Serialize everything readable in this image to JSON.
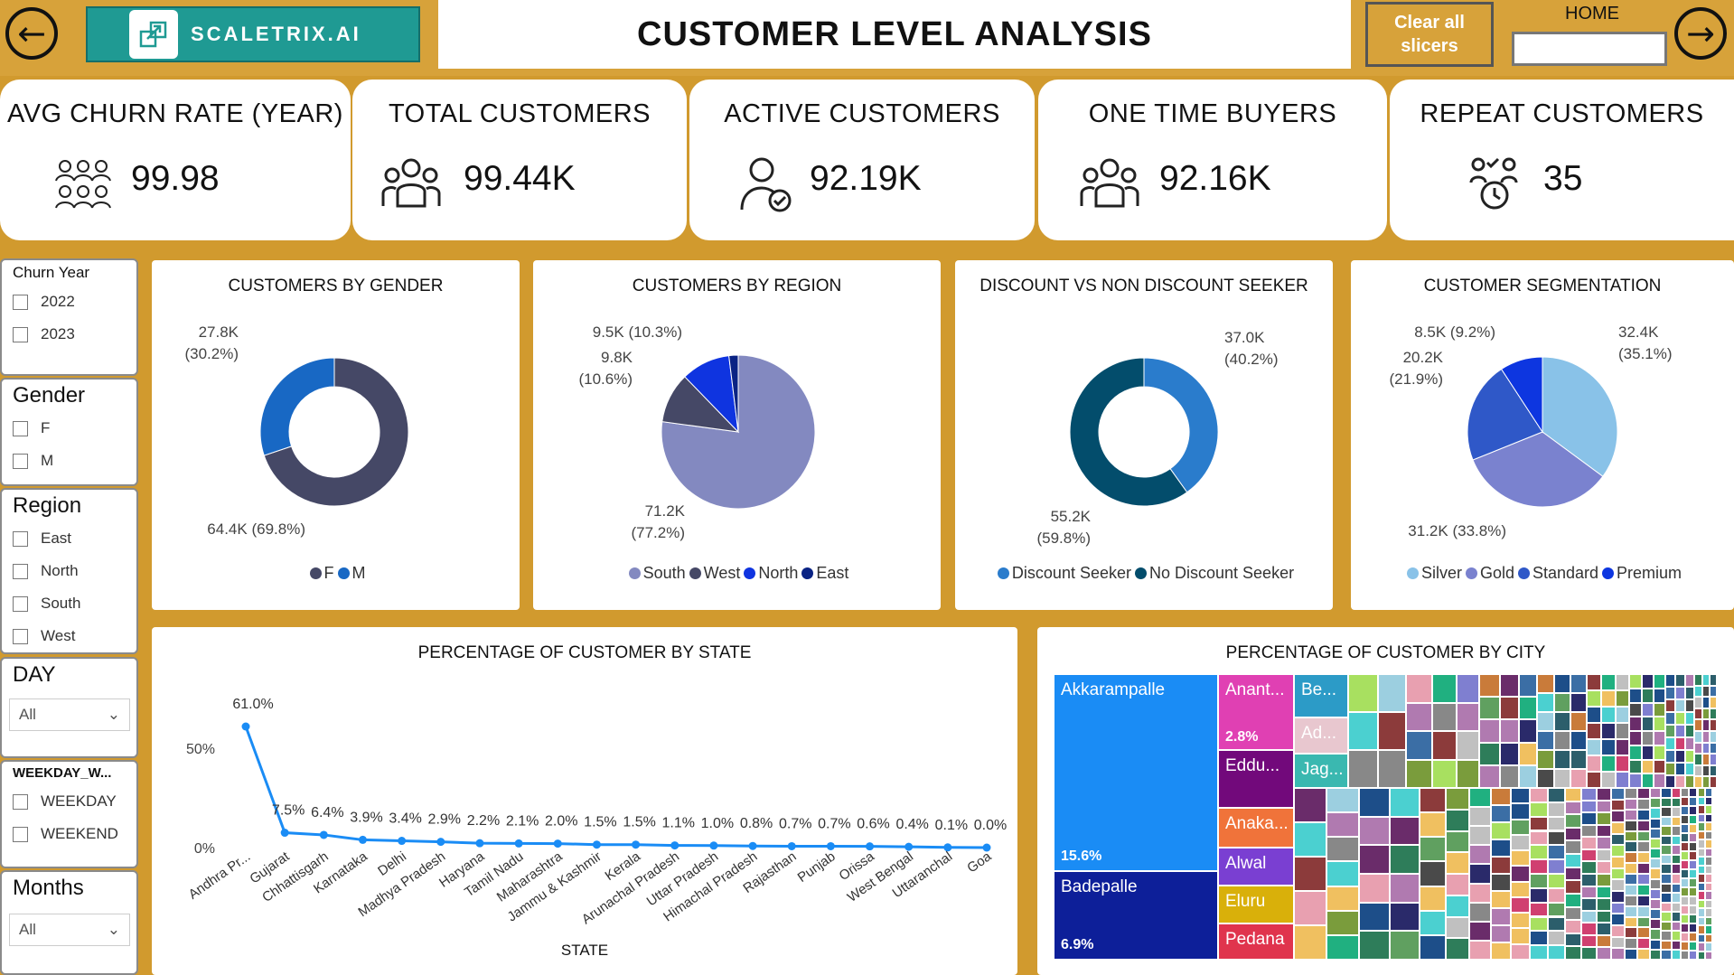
{
  "header": {
    "title": "CUSTOMER LEVEL ANALYSIS",
    "logo_text": "SCALETRIX.AI",
    "clear_label": "Clear all slicers",
    "home_label": "HOME",
    "back_icon": "arrow-left-icon",
    "forward_icon": "arrow-right-icon"
  },
  "kpis": [
    {
      "title": "AVG CHURN RATE (YEAR)",
      "value": "99.98",
      "icon": "churn-group-icon"
    },
    {
      "title": "TOTAL CUSTOMERS",
      "value": "99.44K",
      "icon": "people-icon"
    },
    {
      "title": "ACTIVE CUSTOMERS",
      "value": "92.19K",
      "icon": "user-check-icon"
    },
    {
      "title": "ONE TIME BUYERS",
      "value": "92.16K",
      "icon": "people-icon"
    },
    {
      "title": "REPEAT CUSTOMERS",
      "value": "35",
      "icon": "repeat-customer-icon"
    }
  ],
  "slicers": {
    "churn_year": {
      "title": "Churn Year",
      "options": [
        "2022",
        "2023"
      ]
    },
    "gender": {
      "title": "Gender",
      "options": [
        "F",
        "M"
      ]
    },
    "region": {
      "title": "Region",
      "options": [
        "East",
        "North",
        "South",
        "West"
      ]
    },
    "day": {
      "title": "DAY",
      "value": "All"
    },
    "weekday": {
      "title": "WEEKDAY_W...",
      "options": [
        "WEEKDAY",
        "WEEKEND"
      ]
    },
    "months": {
      "title": "Months",
      "value": "All"
    }
  },
  "colors": {
    "navy_gray": "#454866",
    "blue": "#1868c4",
    "lavender": "#8389c0",
    "bright_blue": "#0f34e0",
    "dark_blue": "#0a2384",
    "discount": "#2a7ccc",
    "no_discount": "#034d6c",
    "silver": "#89c2e8",
    "gold": "#7a82cf",
    "standard": "#2f58c8",
    "premium": "#0d36e0",
    "accent": "#d19a2e"
  },
  "chart_data": [
    {
      "type": "pie",
      "title": "CUSTOMERS BY GENDER",
      "donut": true,
      "slices": [
        {
          "name": "F",
          "value": 27.8,
          "label": "27.8K",
          "pct": "(30.2%)",
          "color": "#1868c4"
        },
        {
          "name": "M",
          "value": 64.4,
          "label": "64.4K",
          "pct": "(69.8%)",
          "color": "#454866"
        }
      ],
      "legend": [
        "F",
        "M"
      ],
      "legend_colors": [
        "#454866",
        "#1868c4"
      ]
    },
    {
      "type": "pie",
      "title": "CUSTOMERS BY REGION",
      "slices": [
        {
          "name": "South",
          "value": 71.2,
          "label": "71.2K",
          "pct": "(77.2%)",
          "color": "#8389c0"
        },
        {
          "name": "West",
          "value": 9.8,
          "label": "9.8K",
          "pct": "(10.6%)",
          "color": "#454866"
        },
        {
          "name": "North",
          "value": 9.5,
          "label": "9.5K",
          "pct": "(10.3%)",
          "color": "#0f34e0"
        },
        {
          "name": "East",
          "value": 1.8,
          "label": "",
          "pct": "",
          "color": "#0a2384"
        }
      ],
      "legend": [
        "South",
        "West",
        "North",
        "East"
      ]
    },
    {
      "type": "pie",
      "title": "DISCOUNT VS NON DISCOUNT SEEKER",
      "donut": true,
      "slices": [
        {
          "name": "Discount Seeker",
          "value": 37.0,
          "label": "37.0K",
          "pct": "(40.2%)",
          "color": "#2a7ccc"
        },
        {
          "name": "No Discount Seeker",
          "value": 55.2,
          "label": "55.2K",
          "pct": "(59.8%)",
          "color": "#034d6c"
        }
      ],
      "legend": [
        "Discount Seeker",
        "No Discount Seeker"
      ]
    },
    {
      "type": "pie",
      "title": "CUSTOMER SEGMENTATION",
      "slices": [
        {
          "name": "Silver",
          "value": 32.4,
          "label": "32.4K",
          "pct": "(35.1%)",
          "color": "#89c2e8"
        },
        {
          "name": "Gold",
          "value": 31.2,
          "label": "31.2K",
          "pct": "(33.8%)",
          "color": "#7a82cf"
        },
        {
          "name": "Standard",
          "value": 20.2,
          "label": "20.2K",
          "pct": "(21.9%)",
          "color": "#2f58c8"
        },
        {
          "name": "Premium",
          "value": 8.5,
          "label": "8.5K",
          "pct": "(9.2%)",
          "color": "#0d36e0"
        }
      ],
      "legend": [
        "Silver",
        "Gold",
        "Standard",
        "Premium"
      ]
    },
    {
      "type": "line",
      "title": "PERCENTAGE OF CUSTOMER BY STATE",
      "xlabel": "STATE",
      "ylabel": "",
      "y_ticks": [
        "50%",
        "0%"
      ],
      "ylim": [
        0,
        61
      ],
      "categories": [
        "Andhra Pr...",
        "Gujarat",
        "Chhattisgarh",
        "Karnataka",
        "Delhi",
        "Madhya Pradesh",
        "Haryana",
        "Tamil Nadu",
        "Maharashtra",
        "Jammu & Kashmir",
        "Kerala",
        "Arunachal Pradesh",
        "Uttar Pradesh",
        "Himachal Pradesh",
        "Rajasthan",
        "Punjab",
        "Orissa",
        "West Bengal",
        "Uttaranchal",
        "Goa"
      ],
      "values": [
        61.0,
        7.5,
        6.4,
        3.9,
        3.4,
        2.9,
        2.2,
        2.1,
        2.0,
        1.5,
        1.5,
        1.1,
        1.0,
        0.8,
        0.7,
        0.7,
        0.6,
        0.4,
        0.1,
        0.0
      ],
      "labels": [
        "61.0%",
        "7.5%",
        "6.4%",
        "3.9%",
        "3.4%",
        "2.9%",
        "2.2%",
        "2.1%",
        "2.0%",
        "1.5%",
        "1.5%",
        "1.1%",
        "1.0%",
        "0.8%",
        "0.7%",
        "0.7%",
        "0.6%",
        "0.4%",
        "0.1%",
        "0.0%"
      ]
    },
    {
      "type": "treemap",
      "title": "PERCENTAGE OF CUSTOMER BY CITY",
      "items": [
        {
          "name": "Akkarampalle",
          "value": "15.6%"
        },
        {
          "name": "Badepalle",
          "value": "6.9%"
        },
        {
          "name": "Anant...",
          "value": "2.8%"
        },
        {
          "name": "Eddu...",
          "value": ""
        },
        {
          "name": "Anaka...",
          "value": ""
        },
        {
          "name": "Alwal",
          "value": ""
        },
        {
          "name": "Eluru",
          "value": ""
        },
        {
          "name": "Pedana",
          "value": ""
        },
        {
          "name": "Be...",
          "value": ""
        },
        {
          "name": "Ad...",
          "value": ""
        },
        {
          "name": "Jag...",
          "value": ""
        }
      ]
    }
  ]
}
